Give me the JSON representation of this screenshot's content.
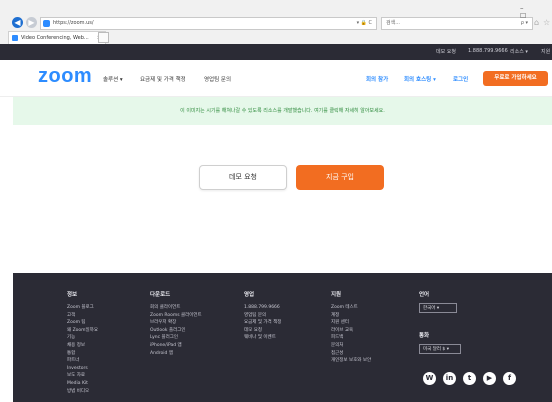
{
  "browser": {
    "url": "https://zoom.us/",
    "address_controls": "▾ 🔒 C",
    "search_placeholder": "검색...",
    "search_icon": "ρ ▾",
    "window_controls": "– ☐",
    "tab_label": "Video Conferencing, Web...",
    "tab_close": "×"
  },
  "topbar": {
    "links": [
      "데모 요청",
      "1.888.799.9666",
      "리소스 ▾",
      "지원"
    ]
  },
  "header": {
    "logo": "zoom",
    "nav": [
      "솔루션 ▾",
      "요금제 및 가격 책정",
      "영업팀 문의"
    ],
    "right_links": [
      "회의 참가",
      "회의 호스팅 ▾",
      "로그인"
    ],
    "cta_label": "무료로 가입하세요"
  },
  "banner": {
    "text": "이 이미지는 시기를 해쳐나갈 수 있도록 리소스를 개발했습니다. 여기를 클릭해 자세히 알아보세요."
  },
  "hero": {
    "demo_label": "데모 요청",
    "buy_label": "지금 구입"
  },
  "footer": {
    "columns": [
      {
        "title": "정보",
        "links": [
          "Zoom 블로그",
          "고객",
          "Zoom 팀",
          "왜 Zoom일까요",
          "기능",
          "채용 정보",
          "통합",
          "파트너",
          "Investors",
          "보도 자료",
          "Media Kit",
          "방법 비디오"
        ]
      },
      {
        "title": "다운로드",
        "links": [
          "회의 클라이언트",
          "Zoom Rooms 클라이언트",
          "브라우저 확장",
          "Outlook 플러그인",
          "Lync 플러그인",
          "iPhone/iPad 앱",
          "Android 앱"
        ]
      },
      {
        "title": "영업",
        "links": [
          "1.888.799.9666",
          "영업팀 문의",
          "요금제 및 가격 책정",
          "데모 요청",
          "웨비나 및 이벤트"
        ]
      },
      {
        "title": "지원",
        "links": [
          "Zoom 테스트",
          "계정",
          "지원 센터",
          "라이브 교육",
          "피드백",
          "문의처",
          "접근성",
          "개인정보 보호와 보안"
        ]
      }
    ],
    "language": {
      "title": "언어",
      "value": "한국어 ▾"
    },
    "currency": {
      "title": "통화",
      "value": "미국 달러 $ ▾"
    },
    "social_icons": [
      "wordpress-icon",
      "linkedin-icon",
      "twitter-icon",
      "youtube-icon",
      "facebook-icon"
    ],
    "social_glyphs": [
      "W",
      "in",
      "t",
      "▶",
      "f"
    ]
  },
  "colors": {
    "brand_blue": "#2d8cff",
    "cta_orange": "#f26d21",
    "dark_bg": "#2b2b35",
    "banner_green_bg": "#e6f8ea",
    "banner_green_text": "#2e8a3c"
  }
}
